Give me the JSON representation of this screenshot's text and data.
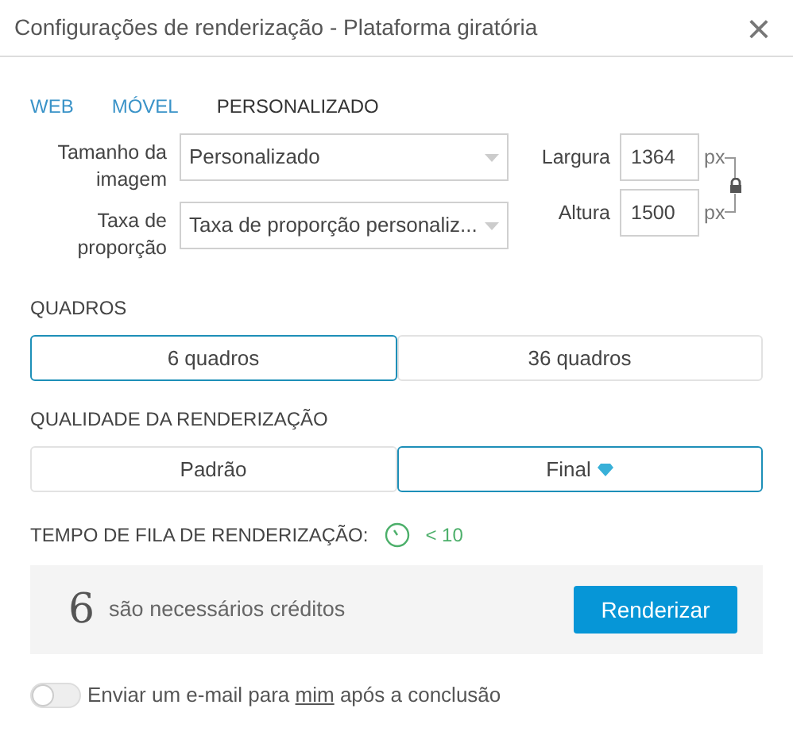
{
  "window": {
    "title": "Configurações de renderização - Plataforma giratória",
    "close": "×"
  },
  "tabs": [
    {
      "label": "WEB",
      "selected": false
    },
    {
      "label": "MÓVEL",
      "selected": false
    },
    {
      "label": "PERSONALIZADO",
      "selected": true
    }
  ],
  "image_size": {
    "label": "Tamanho da imagem",
    "value": "Personalizado"
  },
  "aspect_ratio": {
    "label": "Taxa de proporção",
    "value": "Taxa de proporção personaliz..."
  },
  "width": {
    "label": "Largura",
    "value": "1364",
    "unit": "px"
  },
  "height": {
    "label": "Altura",
    "value": "1500",
    "unit": "px"
  },
  "frames": {
    "title": "QUADROS",
    "options": [
      {
        "label": "6 quadros",
        "selected": true
      },
      {
        "label": "36 quadros",
        "selected": false
      }
    ]
  },
  "quality": {
    "title": "QUALIDADE DA RENDERIZAÇÃO",
    "options": [
      {
        "label": "Padrão",
        "selected": false,
        "premium": false
      },
      {
        "label": "Final",
        "selected": true,
        "premium": true
      }
    ]
  },
  "queue": {
    "label": "TEMPO DE FILA DE RENDERIZAÇÃO:",
    "value": "< 10"
  },
  "credits": {
    "count": "6",
    "text": "são necessários créditos",
    "button": "Renderizar"
  },
  "email": {
    "on": false,
    "before": "Enviar um e-mail para",
    "link": "mim",
    "after": "após a conclusão"
  }
}
